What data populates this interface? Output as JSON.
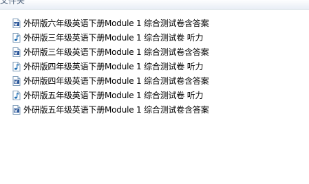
{
  "header": {
    "label": "文件夹"
  },
  "files": [
    {
      "name": "外研版六年级英语下册Module 1 综合测试卷含答案",
      "icon": "word-document-icon"
    },
    {
      "name": "外研版三年级英语下册Module 1 综合测试卷 听力",
      "icon": "audio-file-icon"
    },
    {
      "name": "外研版三年级英语下册Module 1 综合测试卷含答案",
      "icon": "word-document-icon"
    },
    {
      "name": "外研版四年级英语下册Module 1 综合测试卷 听力",
      "icon": "audio-file-icon"
    },
    {
      "name": "外研版四年级英语下册Module 1 综合测试卷含答案",
      "icon": "word-document-icon"
    },
    {
      "name": "外研版五年级英语下册Module 1 综合测试卷 听力",
      "icon": "audio-file-icon"
    },
    {
      "name": "外研版五年级英语下册Module 1 综合测试卷含答案",
      "icon": "word-document-icon"
    }
  ],
  "colors": {
    "word_icon": "#2b579a",
    "audio_icon": "#1f6fb5",
    "header_text": "#4c607a"
  }
}
